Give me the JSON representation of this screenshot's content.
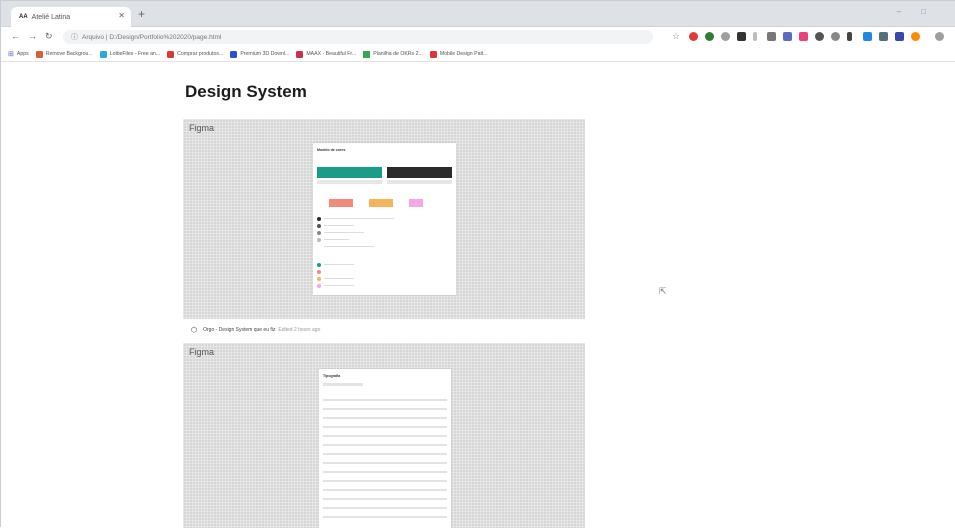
{
  "browser": {
    "tab_title": "Atelié Latina",
    "tab_favicon": "AA",
    "url": "Arquivo | D:/Design/Portfolio%202020/page.html",
    "bookmarks": [
      {
        "label": "Apps",
        "icon": "apps-grid-icon",
        "color": "#4a6bd4"
      },
      {
        "label": "Remove Backgrou...",
        "icon": "bookmark-icon",
        "color": "#e05c3a"
      },
      {
        "label": "LottieFiles - Free an...",
        "icon": "lottie-icon",
        "color": "#2aa9e0"
      },
      {
        "label": "Comprar produtos...",
        "icon": "store-icon",
        "color": "#d93a3a"
      },
      {
        "label": "Premium 3D Downl...",
        "icon": "download-icon",
        "color": "#2d4fd0"
      },
      {
        "label": "MAAX - Beautiful Fr...",
        "icon": "maax-icon",
        "color": "#c9314d"
      },
      {
        "label": "Planilha de OKRs 2...",
        "icon": "drive-icon",
        "color": "#34a853"
      },
      {
        "label": "Mobile Design Patt...",
        "icon": "mobile-icon",
        "color": "#e0323a"
      }
    ]
  },
  "page": {
    "title": "Design System",
    "embeds": [
      {
        "label": "Figma",
        "footer_title": "Orgo - Design System que eu fiz",
        "footer_meta": "Edited 2 hours ago"
      },
      {
        "label": "Figma"
      }
    ],
    "card1": {
      "heading": "Modelo de cores"
    },
    "card2": {
      "heading": "Tipografia"
    }
  },
  "colors": {
    "teal": "#1a9c8a",
    "dark": "#2b2b2b",
    "coral": "#f28a7a",
    "orange": "#f6b45a",
    "pink": "#f4a6e6"
  }
}
